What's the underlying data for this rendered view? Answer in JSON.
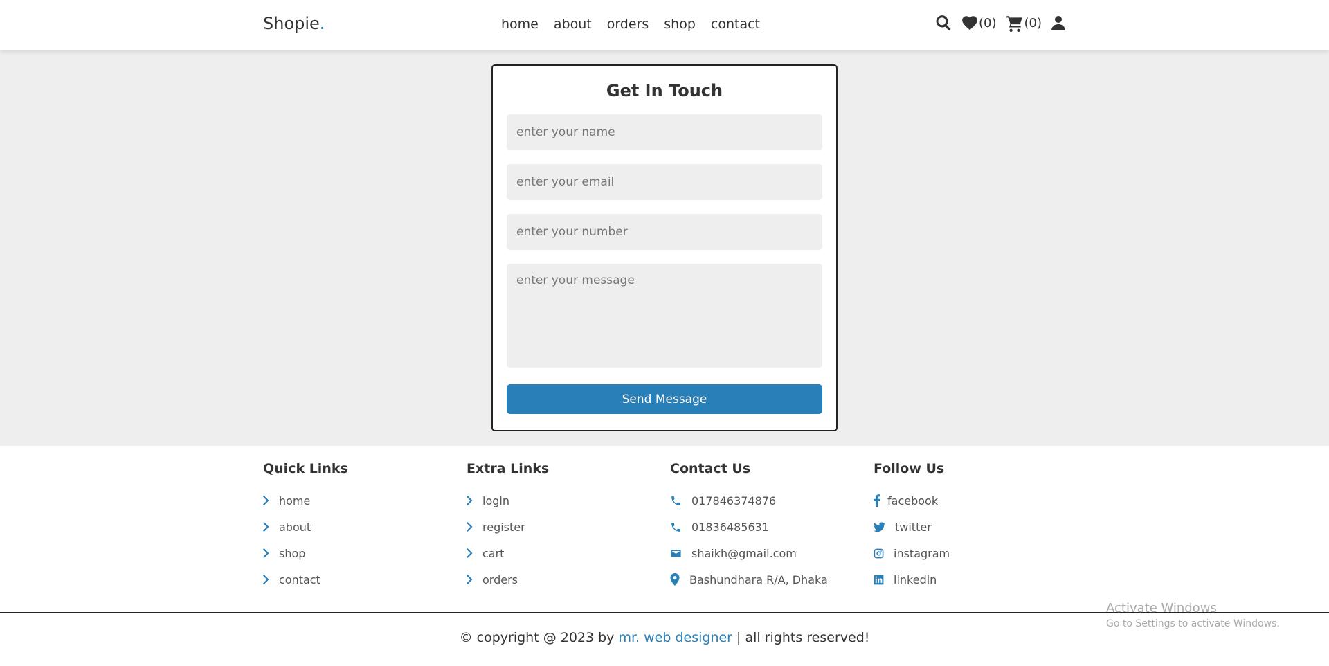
{
  "header": {
    "logo": "Shopie",
    "logo_dot": ".",
    "nav": [
      "home",
      "about",
      "orders",
      "shop",
      "contact"
    ],
    "wishlist_count": "(0)",
    "cart_count": "(0)",
    "icons": [
      "search-icon",
      "heart-icon",
      "cart-icon",
      "user-icon"
    ]
  },
  "form": {
    "title": "Get In Touch",
    "name_placeholder": "enter your name",
    "email_placeholder": "enter your email",
    "number_placeholder": "enter your number",
    "message_placeholder": "enter your message",
    "submit_label": "Send Message"
  },
  "footer": {
    "quick_links": {
      "title": "Quick Links",
      "items": [
        "home",
        "about",
        "shop",
        "contact"
      ]
    },
    "extra_links": {
      "title": "Extra Links",
      "items": [
        "login",
        "register",
        "cart",
        "orders"
      ]
    },
    "contact_us": {
      "title": "Contact Us",
      "items": [
        "017846374876",
        "01836485631",
        "shaikh@gmail.com",
        "Bashundhara R/A, Dhaka"
      ]
    },
    "follow_us": {
      "title": "Follow Us",
      "items": [
        "facebook",
        "twitter",
        "instagram",
        "linkedin"
      ]
    },
    "copyright_prefix": "© copyright @ 2023 by ",
    "copyright_author": "mr. web designer",
    "copyright_suffix": " | all rights reserved!"
  },
  "watermark": {
    "line1": "Activate Windows",
    "line2": "Go to Settings to activate Windows."
  },
  "colors": {
    "accent": "#2980b9",
    "background": "#eeeeee",
    "text": "#333333"
  }
}
